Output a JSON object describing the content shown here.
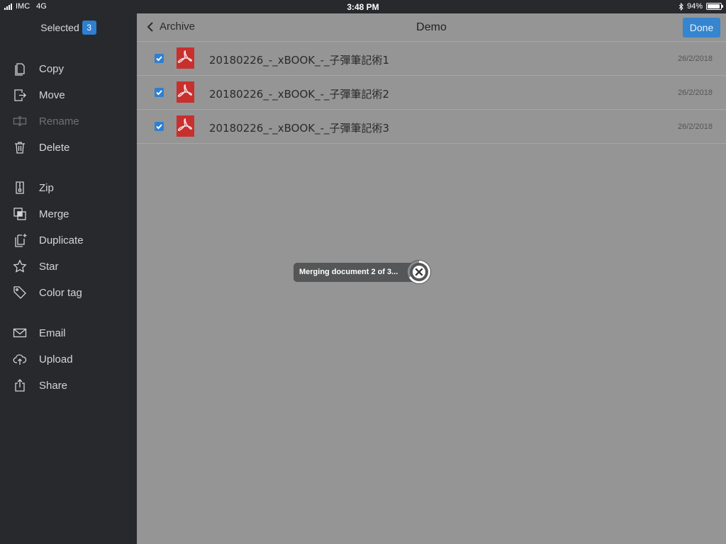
{
  "status_bar": {
    "carrier": "IMC",
    "network": "4G",
    "time": "3:48 PM",
    "battery": "94%",
    "battery_level": 0.94
  },
  "sidebar": {
    "header": {
      "title": "Selected",
      "count": "3"
    },
    "items": [
      {
        "label": "Copy",
        "icon": "copy-icon",
        "enabled": true
      },
      {
        "label": "Move",
        "icon": "move-icon",
        "enabled": true
      },
      {
        "label": "Rename",
        "icon": "rename-icon",
        "enabled": false
      },
      {
        "label": "Delete",
        "icon": "trash-icon",
        "enabled": true
      },
      {
        "label": "Zip",
        "icon": "zip-icon",
        "enabled": true
      },
      {
        "label": "Merge",
        "icon": "merge-icon",
        "enabled": true
      },
      {
        "label": "Duplicate",
        "icon": "duplicate-icon",
        "enabled": true
      },
      {
        "label": "Star",
        "icon": "star-icon",
        "enabled": true
      },
      {
        "label": "Color tag",
        "icon": "tag-icon",
        "enabled": true
      },
      {
        "label": "Email",
        "icon": "mail-icon",
        "enabled": true
      },
      {
        "label": "Upload",
        "icon": "cloud-upload-icon",
        "enabled": true
      },
      {
        "label": "Share",
        "icon": "share-icon",
        "enabled": true
      }
    ]
  },
  "navbar": {
    "back_label": "Archive",
    "title": "Demo",
    "done_label": "Done"
  },
  "files": [
    {
      "name": "20180226_-_xBOOK_-_子彈筆記術1",
      "date": "26/2/2018",
      "checked": true
    },
    {
      "name": "20180226_-_xBOOK_-_子彈筆記術2",
      "date": "26/2/2018",
      "checked": true
    },
    {
      "name": "20180226_-_xBOOK_-_子彈筆記術3",
      "date": "26/2/2018",
      "checked": true
    }
  ],
  "progress": {
    "message": "Merging document 2 of 3...",
    "fraction": 0.67
  },
  "colors": {
    "accent": "#2f7fd0",
    "sidebar_bg": "#27292d",
    "pdf_red": "#c8302d"
  }
}
